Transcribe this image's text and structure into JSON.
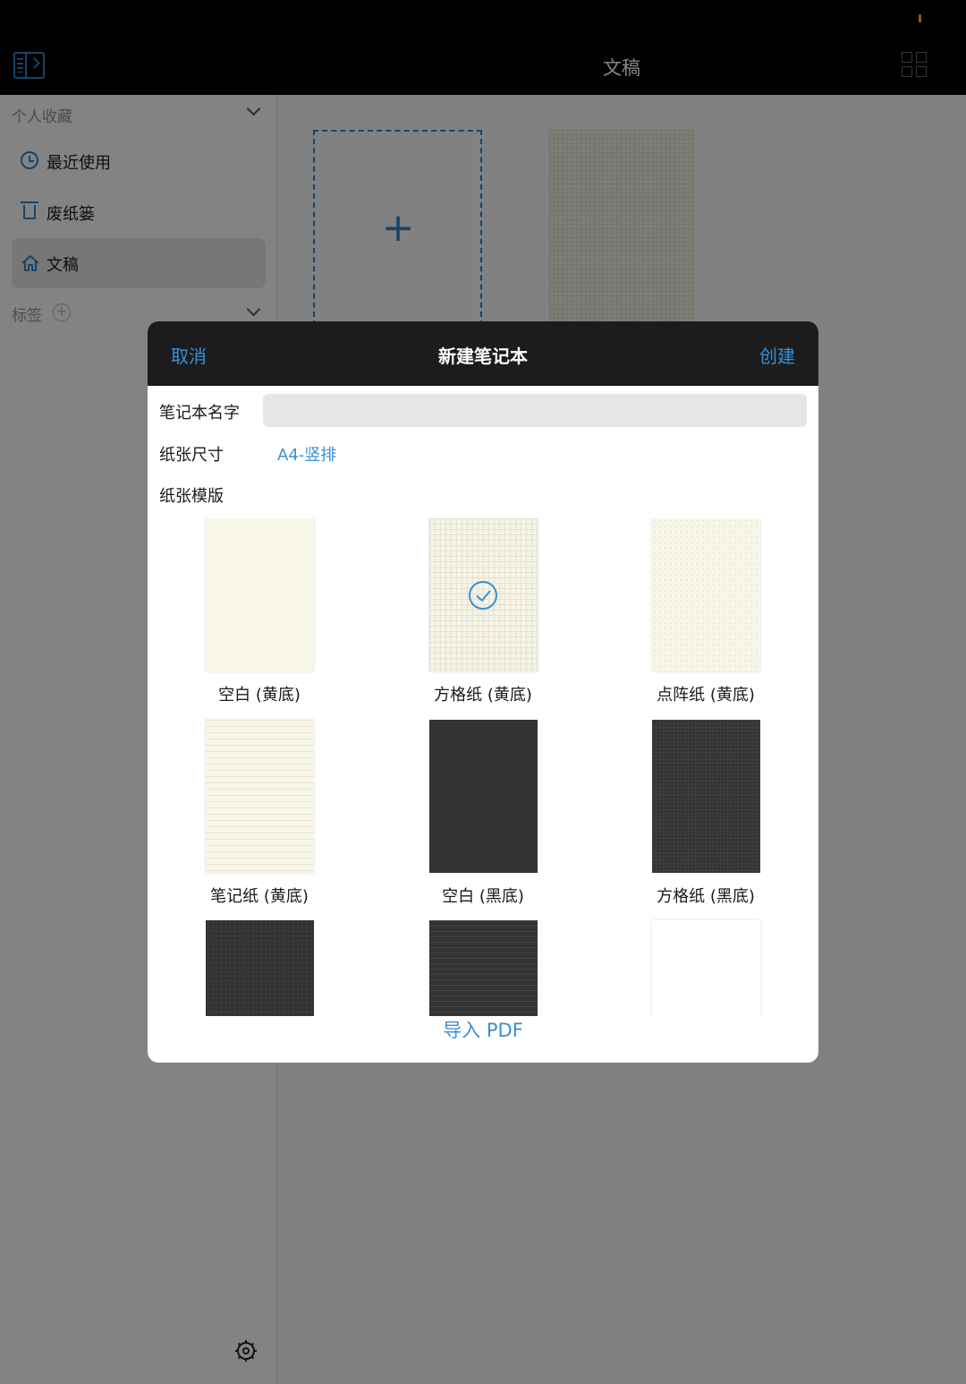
{
  "topbar": {
    "title": "文稿"
  },
  "sidebar": {
    "favorites_header": "个人收藏",
    "items": [
      {
        "label": "最近使用",
        "icon": "clock-icon"
      },
      {
        "label": "废纸篓",
        "icon": "trash-icon"
      },
      {
        "label": "文稿",
        "icon": "home-icon",
        "active": true
      }
    ],
    "tags_header": "标签",
    "add_tag_symbol": "+"
  },
  "main": {
    "new_doc_symbol": "+"
  },
  "modal": {
    "cancel": "取消",
    "title": "新建笔记本",
    "create": "创建",
    "name_label": "笔记本名字",
    "name_placeholder": "",
    "size_label": "纸张尺寸",
    "size_value": "A4-竖排",
    "template_label": "纸张模版",
    "templates": [
      {
        "label": "空白 (黄底)",
        "style": "p-blank-y"
      },
      {
        "label": "方格纸 (黄底)",
        "style": "p-grid-y",
        "selected": true
      },
      {
        "label": "点阵纸 (黄底)",
        "style": "p-dot-y"
      },
      {
        "label": "笔记纸 (黄底)",
        "style": "p-note-y"
      },
      {
        "label": "空白 (黑底)",
        "style": "p-blank-b"
      },
      {
        "label": "方格纸 (黑底)",
        "style": "p-grid-b"
      },
      {
        "label": "",
        "style": "p-dot-b"
      },
      {
        "label": "",
        "style": "p-note-b"
      },
      {
        "label": "",
        "style": "p-white"
      }
    ],
    "import": "导入 PDF"
  },
  "colors": {
    "accent": "#3a8fd6",
    "header_bg": "#1c1c1e",
    "topbar_bg": "#000000"
  }
}
